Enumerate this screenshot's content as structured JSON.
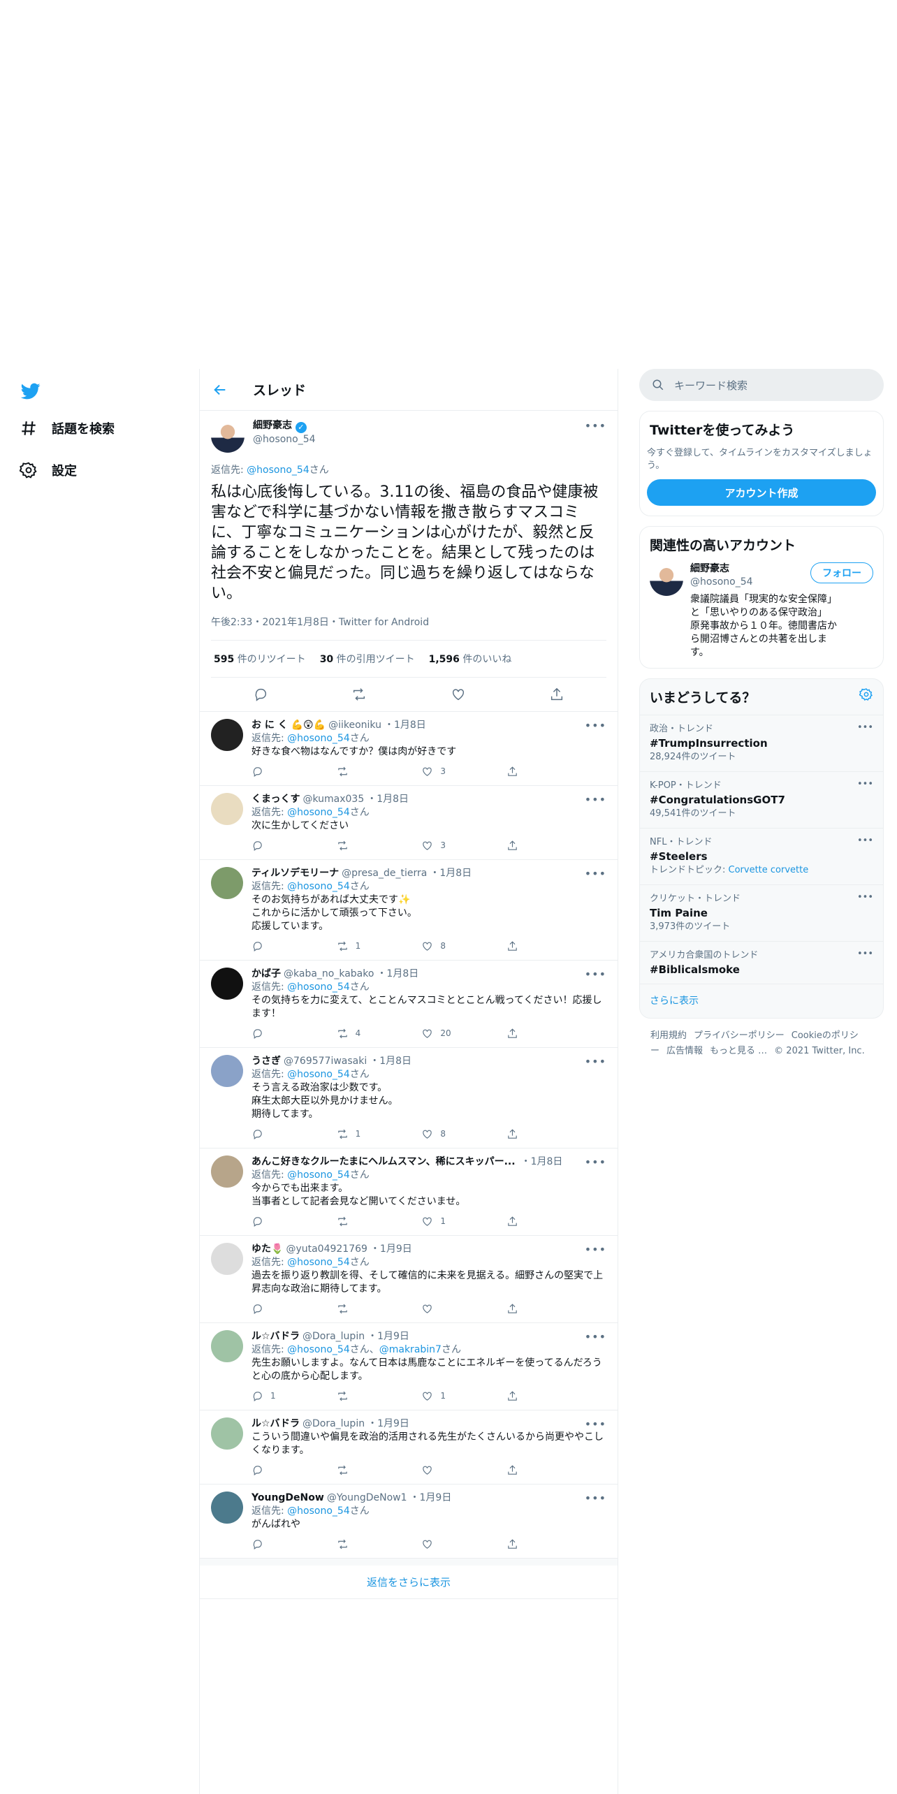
{
  "nav": {
    "explore": "話題を検索",
    "settings": "設定"
  },
  "header": {
    "title": "スレッド"
  },
  "main": {
    "name": "細野豪志",
    "handle": "@hosono_54",
    "replying_prefix": "返信先: ",
    "replying_to": "@hosono_54",
    "replying_suffix": "さん",
    "text": "私は心底後悔している。3.11の後、福島の食品や健康被害などで科学に基づかない情報を撒き散らすマスコミに、丁寧なコミュニケーションは心がけたが、毅然と反論することをしなかったことを。結果として残ったのは社会不安と偏見だった。同じ過ちを繰り返してはならない。",
    "meta": "午後2:33・2021年1月8日・Twitter for Android",
    "retweets": "595",
    "retweets_label": "件のリツイート",
    "quotes": "30",
    "quotes_label": "件の引用ツイート",
    "likes": "1,596",
    "likes_label": "件のいいね"
  },
  "replies": [
    {
      "name": "お に く 💪😲💪",
      "handle": "@iikeoniku",
      "date": "・1月8日",
      "to": "@hosono_54",
      "to2": "",
      "text": "好きな食べ物はなんですか？僕は肉が好きです",
      "reply": "",
      "rt": "",
      "like": "3",
      "avatar": "#222"
    },
    {
      "name": "くまっくす",
      "handle": "@kumax035",
      "date": "・1月8日",
      "to": "@hosono_54",
      "to2": "",
      "text": "次に生かしてください",
      "reply": "",
      "rt": "",
      "like": "3",
      "avatar": "#e9dcc0"
    },
    {
      "name": "ティルソデモリーナ",
      "handle": "@presa_de_tierra",
      "date": "・1月8日",
      "to": "@hosono_54",
      "to2": "",
      "text": "そのお気持ちがあれば大丈夫です✨\nこれからに活かして頑張って下さい。\n応援しています。",
      "reply": "",
      "rt": "1",
      "like": "8",
      "avatar": "#7d9b6a"
    },
    {
      "name": "かば子",
      "handle": "@kaba_no_kabako",
      "date": "・1月8日",
      "to": "@hosono_54",
      "to2": "",
      "text": "その気持ちを力に変えて、とことんマスコミととことん戦ってください！応援します！",
      "reply": "",
      "rt": "4",
      "like": "20",
      "avatar": "#111"
    },
    {
      "name": "うさぎ",
      "handle": "@769577iwasaki",
      "date": "・1月8日",
      "to": "@hosono_54",
      "to2": "",
      "text": "そう言える政治家は少数です。\n麻生太郎大臣以外見かけません。\n期待してます。",
      "reply": "",
      "rt": "1",
      "like": "8",
      "avatar": "#8aa2c8"
    },
    {
      "name": "あんこ好きなクルーたまにヘルムスマン、稀にスキッパー...",
      "handle": "",
      "date": "・1月8日",
      "to": "@hosono_54",
      "to2": "",
      "text": "今からでも出来ます。\n当事者として記者会見など開いてくださいませ。",
      "reply": "",
      "rt": "",
      "like": "1",
      "avatar": "#b7a58a"
    },
    {
      "name": "ゆた🌷",
      "handle": "@yuta04921769",
      "date": "・1月9日",
      "to": "@hosono_54",
      "to2": "",
      "text": "過去を振り返り教訓を得、そして確信的に未来を見据える。細野さんの堅実で上昇志向な政治に期待してます。",
      "reply": "",
      "rt": "",
      "like": "",
      "avatar": "#ddd"
    },
    {
      "name": "ル☆バドラ",
      "handle": "@Dora_lupin",
      "date": "・1月9日",
      "to": "@hosono_54",
      "to2": "@makrabin7",
      "text": "先生お願いしますよ。なんて日本は馬鹿なことにエネルギーを使ってるんだろうと心の底から心配します。",
      "reply": "1",
      "rt": "",
      "like": "1",
      "avatar": "#9fc3a5"
    },
    {
      "name": "ル☆バドラ",
      "handle": "@Dora_lupin",
      "date": "・1月9日",
      "to": "",
      "to2": "",
      "text": "こういう間違いや偏見を政治的活用される先生がたくさんいるから尚更ややこしくなります。",
      "reply": "",
      "rt": "",
      "like": "",
      "avatar": "#9fc3a5"
    },
    {
      "name": "YoungDeNow",
      "handle": "@YoungDeNow1",
      "date": "・1月9日",
      "to": "@hosono_54",
      "to2": "",
      "text": "がんばれや",
      "reply": "",
      "rt": "",
      "like": "",
      "avatar": "#4c7a8c"
    }
  ],
  "show_more": "返信をさらに表示",
  "sidebar": {
    "search_placeholder": "キーワード検索",
    "signup_title": "Twitterを使ってみよう",
    "signup_sub": "今すぐ登録して、タイムラインをカスタマイズしましょう。",
    "signup_btn": "アカウント作成",
    "related_title": "関連性の高いアカウント",
    "related_name": "細野豪志",
    "related_handle": "@hosono_54",
    "follow": "フォロー",
    "related_bio": "衆議院議員「現実的な安全保障」と「思いやりのある保守政治」 原発事故から１０年。徳間書店から開沼博さんとの共著を出します。",
    "trends_title": "いまどうしてる？",
    "trends": [
      {
        "cat": "政治・トレンド",
        "name": "#TrumpInsurrection",
        "sub": "28,924件のツイート",
        "link": ""
      },
      {
        "cat": "K-POP・トレンド",
        "name": "#CongratulationsGOT7",
        "sub": "49,541件のツイート",
        "link": ""
      },
      {
        "cat": "NFL・トレンド",
        "name": "#Steelers",
        "sub": "トレンドトピック: ",
        "link": "Corvette corvette"
      },
      {
        "cat": "クリケット・トレンド",
        "name": "Tim Paine",
        "sub": "3,973件のツイート",
        "link": ""
      },
      {
        "cat": "アメリカ合衆国のトレンド",
        "name": "#Biblicalsmoke",
        "sub": "",
        "link": ""
      }
    ],
    "trends_more": "さらに表示",
    "footer": [
      "利用規約",
      "プライバシーポリシー",
      "Cookieのポリシー",
      "広告情報",
      "もっと見る …",
      "© 2021 Twitter, Inc."
    ]
  }
}
